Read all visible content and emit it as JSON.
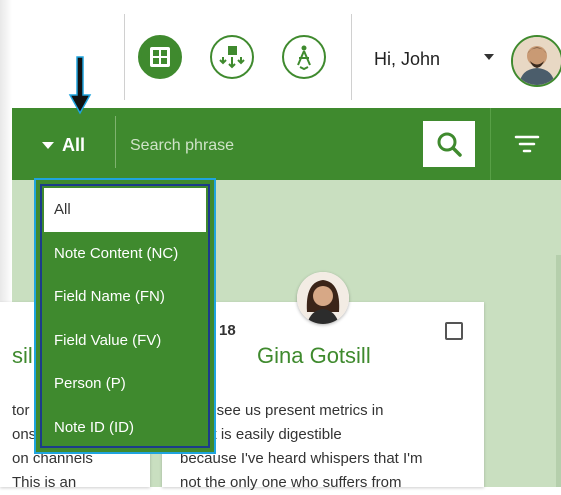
{
  "header": {
    "greeting": "Hi, John",
    "buttons": [
      {
        "icon": "grid-layout-icon"
      },
      {
        "icon": "workflow-arrows-icon"
      },
      {
        "icon": "compass-person-icon"
      }
    ]
  },
  "search": {
    "filter_label": "All",
    "placeholder": "Search phrase",
    "search_icon": "search-icon",
    "filter_icon": "filter-lines-icon"
  },
  "dropdown": {
    "items": [
      "All",
      "Note Content (NC)",
      "Field Name (FN)",
      "Field Value (FV)",
      "Person (P)",
      "Note ID (ID)"
    ],
    "selected_index": 0
  },
  "cards": {
    "left": {
      "title_fragment": "sil",
      "body_lines": [
        "tor",
        "ons",
        "on channels",
        "This is an"
      ]
    },
    "main": {
      "date_fragment": "18",
      "name": "Gina Gotsill",
      "body_lines": [
        "ve to see us present metrics in",
        "y that is easily digestible",
        "because I've heard whispers that I'm",
        "not the only one who suffers from"
      ]
    }
  },
  "colors": {
    "brand_green": "#3f8a2e",
    "content_bg": "#c9dfc0",
    "highlight_border": "#1fa4de"
  },
  "annotation": {
    "icon": "down-arrow-indicator-icon"
  }
}
